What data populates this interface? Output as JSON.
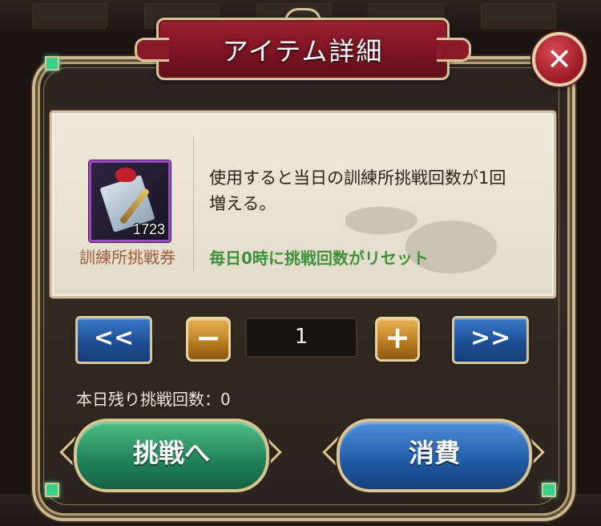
{
  "dialog": {
    "title": "アイテム詳細",
    "close_symbol": "✕"
  },
  "item": {
    "name": "訓練所挑戦券",
    "count": "1723",
    "icon": "training-ticket-scroll-icon",
    "frame_color": "#9b4bc2",
    "description_line1": "使用すると当日の訓練所挑戦回数が1回",
    "description_line2": "増える。",
    "reset_note": "毎日0時に挑戦回数がリセット",
    "reset_note_color": "#3f8f3a"
  },
  "quantity": {
    "min_label": "<<",
    "decrement_label": "−",
    "value": "1",
    "increment_label": "+",
    "max_label": ">>"
  },
  "remaining_text": "本日残り挑戦回数：0",
  "buttons": {
    "challenge_label": "挑戦へ",
    "challenge_color": "#23855a",
    "consume_label": "消費",
    "consume_color": "#235ea9"
  }
}
